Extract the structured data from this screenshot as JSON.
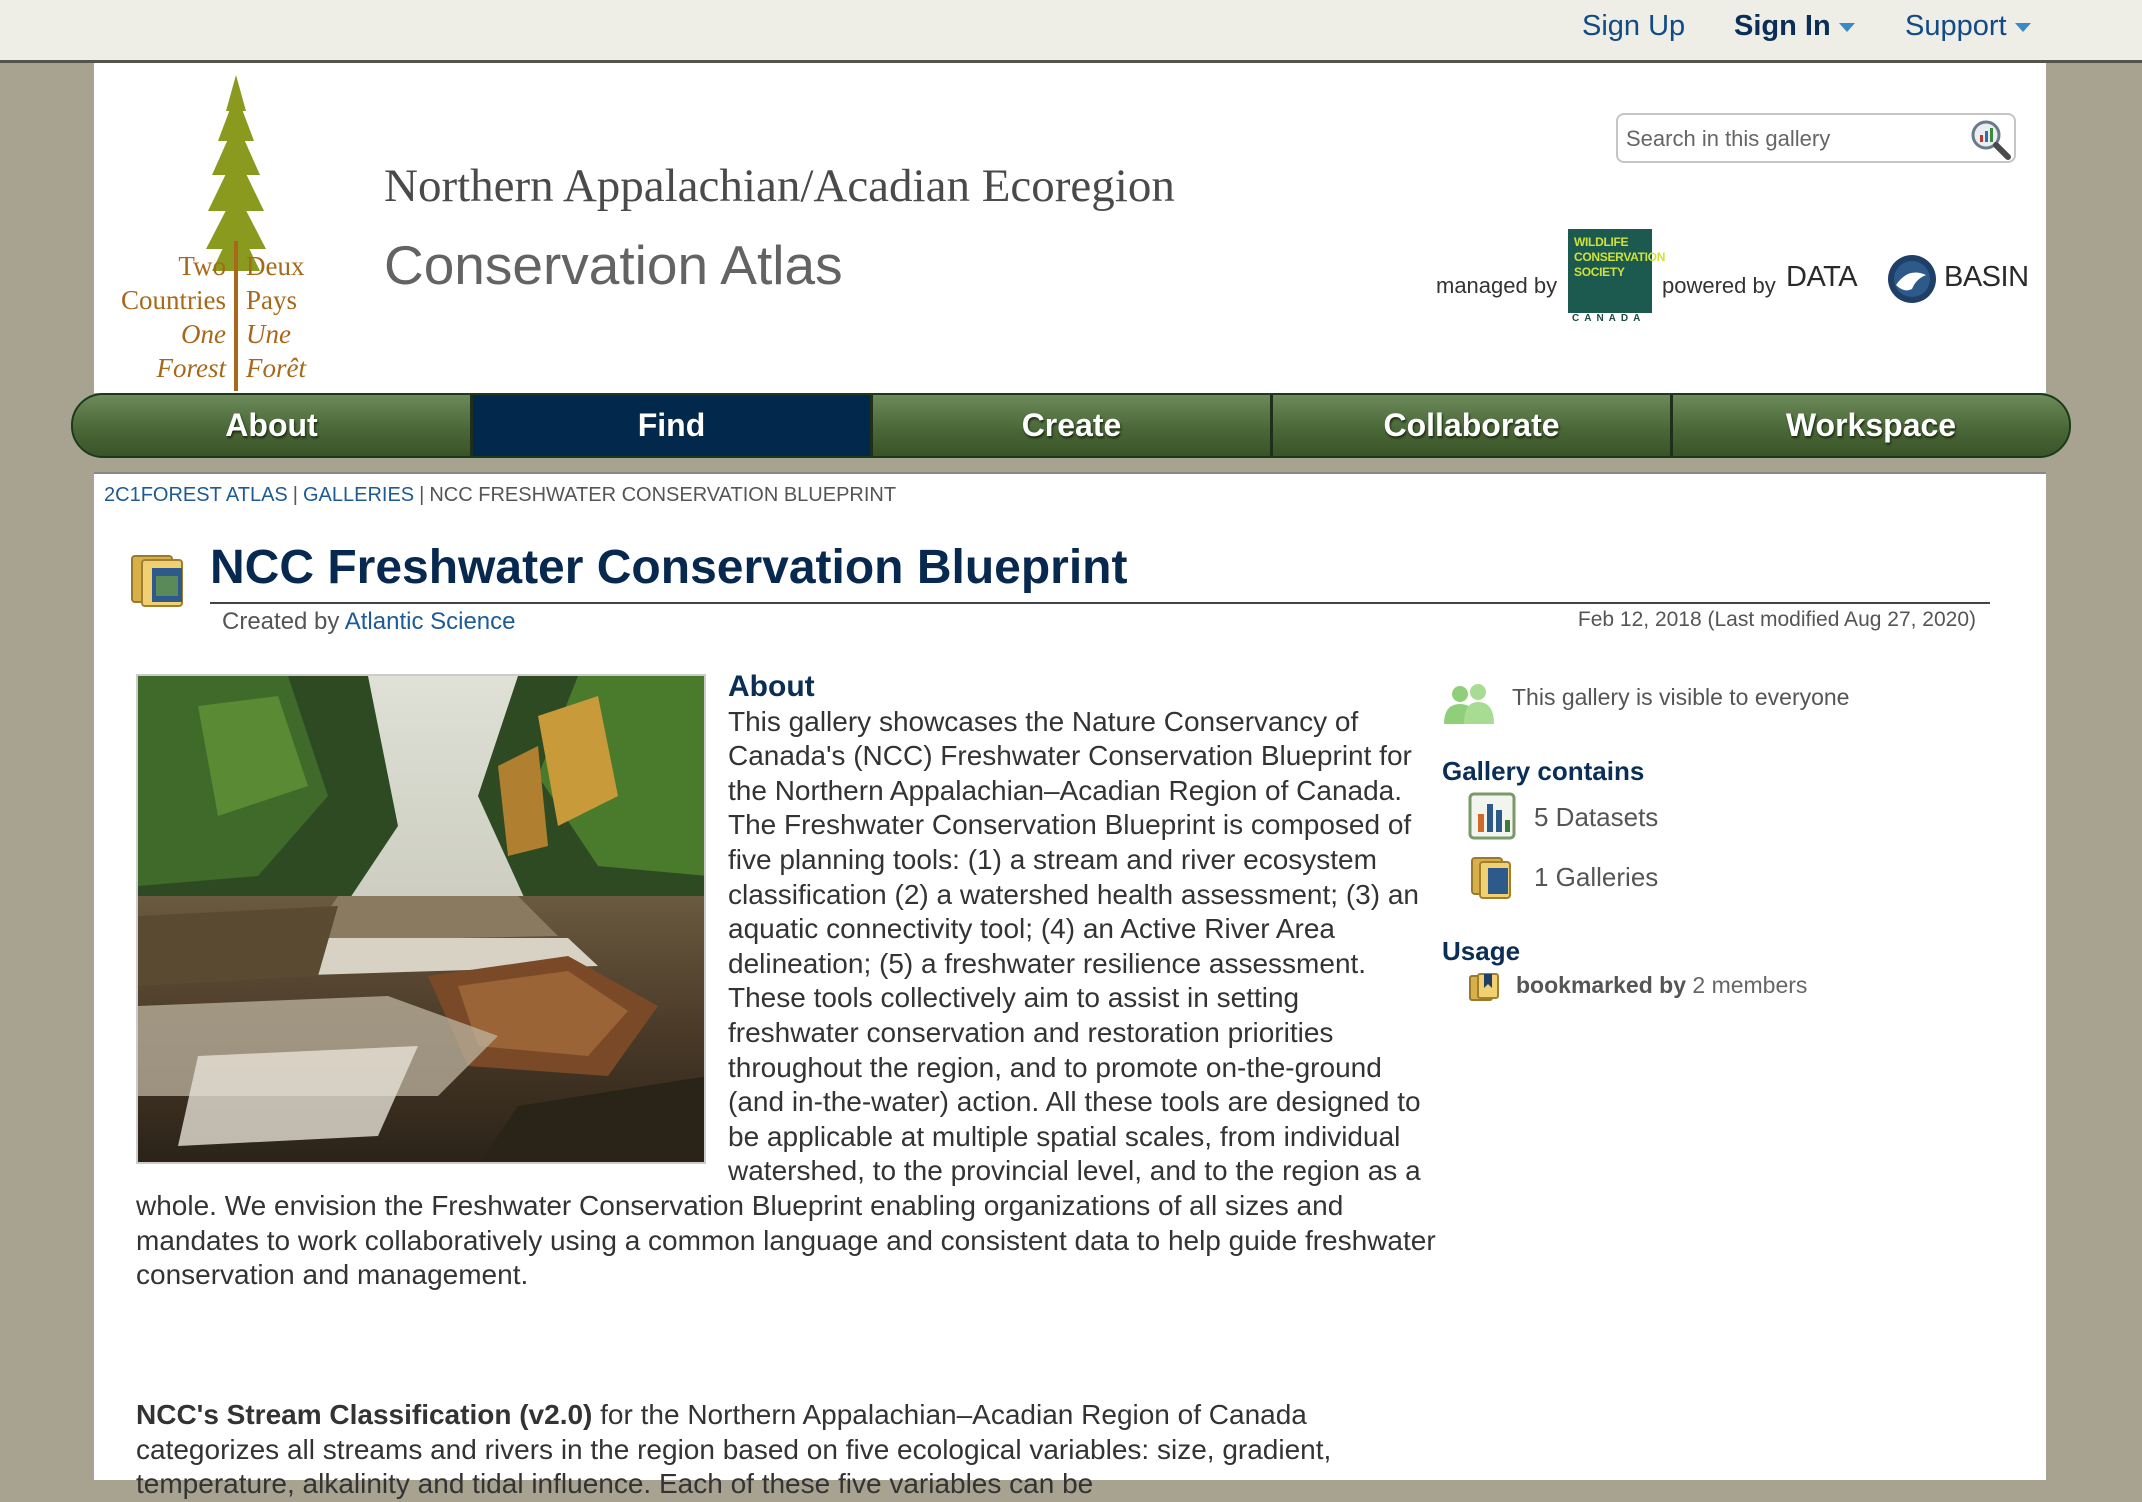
{
  "topbar": {
    "sign_up": "Sign Up",
    "sign_in": "Sign In",
    "support": "Support"
  },
  "header": {
    "logo": {
      "left_lines": [
        "Two",
        "Countries",
        "One",
        "Forest"
      ],
      "right_lines": [
        "Deux",
        "Pays",
        "Une",
        "Forêt"
      ]
    },
    "title_line1": "Northern Appalachian/Acadian Ecoregion",
    "title_line2": "Conservation Atlas",
    "search_placeholder": "Search in this gallery",
    "managed_by": "managed by",
    "powered_by": "powered by",
    "wcs_logo": {
      "line1": "WILDLIFE",
      "line2": "CONSERVATION",
      "line3": "SOCIETY",
      "country": "CANADA"
    },
    "databasin_logo": {
      "left": "DATA",
      "right": "BASIN"
    }
  },
  "nav": {
    "items": [
      {
        "label": "About",
        "active": false
      },
      {
        "label": "Find",
        "active": true
      },
      {
        "label": "Create",
        "active": false
      },
      {
        "label": "Collaborate",
        "active": false
      },
      {
        "label": "Workspace",
        "active": false
      }
    ]
  },
  "breadcrumb": {
    "items": [
      "2C1FOREST ATLAS",
      "GALLERIES"
    ],
    "current": "NCC FRESHWATER CONSERVATION BLUEPRINT"
  },
  "gallery": {
    "title": "NCC Freshwater Conservation Blueprint",
    "created_by_label": "Created by",
    "author": "Atlantic Science",
    "dates": "Feb 12, 2018 (Last modified Aug 27, 2020)",
    "about_heading": "About",
    "about_text": "This gallery showcases the Nature Conservancy of Canada's (NCC) Freshwater Conservation Blueprint for the Northern Appalachian–Acadian Region of Canada. The Freshwater Conservation Blueprint is composed of five planning tools: (1) a stream and river ecosystem classification (2) a watershed health assessment; (3) an aquatic connectivity tool; (4) an Active River Area delineation; (5) a freshwater resilience assessment. These tools collectively aim to assist in setting freshwater conservation and restoration priorities throughout the region, and to promote on-the-ground (and in-the-water) action. All these tools are designed to be applicable at multiple spatial scales, from individual watershed, to the provincial level, and to the region as a whole. We envision the Freshwater Conservation Blueprint enabling organizations of all sizes and mandates to work collaboratively using a common language and consistent data to help guide freshwater conservation and management.",
    "stream_bold": "NCC's Stream Classification (v2.0)",
    "stream_text": " for the Northern Appalachian–Acadian Region of Canada categorizes all streams and rivers in the region based on five ecological variables: size, gradient, temperature, alkalinity and tidal influence. Each of these five variables can be"
  },
  "sidebar": {
    "visibility": "This gallery is visible to everyone",
    "contains_heading": "Gallery contains",
    "contains": [
      {
        "label": "5 Datasets",
        "icon": "datasets-icon"
      },
      {
        "label": "1 Galleries",
        "icon": "galleries-icon"
      }
    ],
    "usage_heading": "Usage",
    "bookmarked_label": "bookmarked by",
    "bookmarked_count": "2 members"
  },
  "colors": {
    "nav_green": "#4a6838",
    "nav_active": "#02294c",
    "title_navy": "#07294f",
    "link_blue": "#1d5a96",
    "page_background": "#a8a391"
  }
}
